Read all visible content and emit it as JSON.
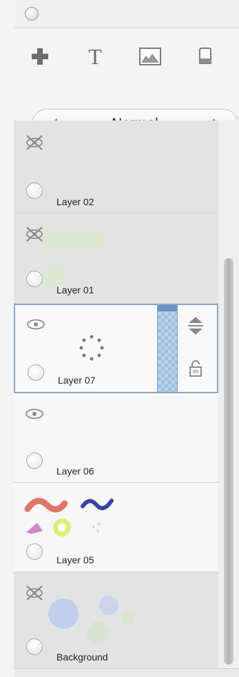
{
  "toolbar": {
    "icons": [
      "add-layer-icon",
      "text-layer-icon",
      "image-layer-icon",
      "eraser-icon"
    ]
  },
  "blend_mode": {
    "selected": "Normal",
    "prev_icon": "triangle-left-icon",
    "next_icon": "triangle-right-icon"
  },
  "layers": [
    {
      "name": "Layer 02",
      "visible": false,
      "selected": false
    },
    {
      "name": "Layer 01",
      "visible": false,
      "selected": false
    },
    {
      "name": "Layer 07",
      "visible": true,
      "selected": true
    },
    {
      "name": "Layer 06",
      "visible": true,
      "selected": false
    },
    {
      "name": "Layer 05",
      "visible": true,
      "selected": false
    },
    {
      "name": "Background",
      "visible": false,
      "selected": false
    }
  ],
  "colors": {
    "selection_border": "#8aa6c8",
    "opacity_handle": "#8fb3d9",
    "hidden_layer_bg": "#e3e3e3",
    "visible_layer_bg": "#f7f7f7"
  }
}
